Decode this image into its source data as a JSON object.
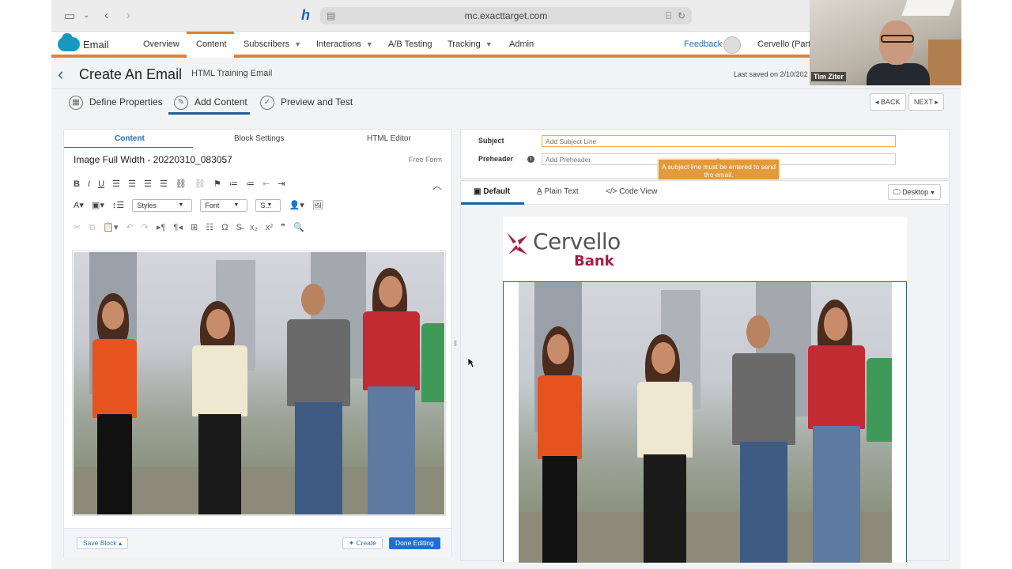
{
  "browser": {
    "url": "mc.exacttarget.com"
  },
  "app": {
    "name": "Email",
    "nav": [
      {
        "label": "Overview",
        "has_caret": false
      },
      {
        "label": "Content",
        "has_caret": false,
        "active": true
      },
      {
        "label": "Subscribers",
        "has_caret": true
      },
      {
        "label": "Interactions",
        "has_caret": true
      },
      {
        "label": "A/B Testing",
        "has_caret": false
      },
      {
        "label": "Tracking",
        "has_caret": true
      },
      {
        "label": "Admin",
        "has_caret": false
      }
    ],
    "feedback": "Feedback",
    "account": "Cervello (Partn"
  },
  "header": {
    "title": "Create An Email",
    "subtitle": "HTML Training Email",
    "last_saved": "Last saved on 2/10/202"
  },
  "steps": [
    {
      "label": "Define Properties",
      "icon": "properties-icon"
    },
    {
      "label": "Add Content",
      "icon": "pencil-icon",
      "active": true
    },
    {
      "label": "Preview and Test",
      "icon": "check-icon"
    }
  ],
  "step_nav": {
    "back": "BACK",
    "next": "NEXT"
  },
  "editor": {
    "tabs": [
      "Content",
      "Block Settings",
      "HTML Editor"
    ],
    "active_tab": "Content",
    "block_title": "Image Full Width - 20220310_083057",
    "block_type": "Free Form",
    "toolbar_row2": {
      "styles": "Styles",
      "font": "Font",
      "size": "S..."
    },
    "footer": {
      "save": "Save Block",
      "create": "Create",
      "done": "Done Editing"
    }
  },
  "email_fields": {
    "subject_label": "Subject",
    "subject_placeholder": "Add Subject Line",
    "preheader_label": "Preheader",
    "preheader_placeholder": "Add Preheader",
    "tooltip": "A subject line must be entered to send the email."
  },
  "preview": {
    "tabs": [
      {
        "label": "Default",
        "icon": "layout-icon",
        "active": true
      },
      {
        "label": "Plain Text",
        "icon": "text-a-icon"
      },
      {
        "label": "Code View",
        "icon": "code-icon"
      }
    ],
    "device": "Desktop",
    "brand_name": "Cervello",
    "brand_sub": "Bank",
    "brand_color": "#a61e45"
  },
  "webcam": {
    "participant": "Tim Ziter"
  },
  "colors": {
    "accent_orange": "#e0822f",
    "link_blue": "#2a6db0",
    "primary_button": "#1f6fd1"
  }
}
